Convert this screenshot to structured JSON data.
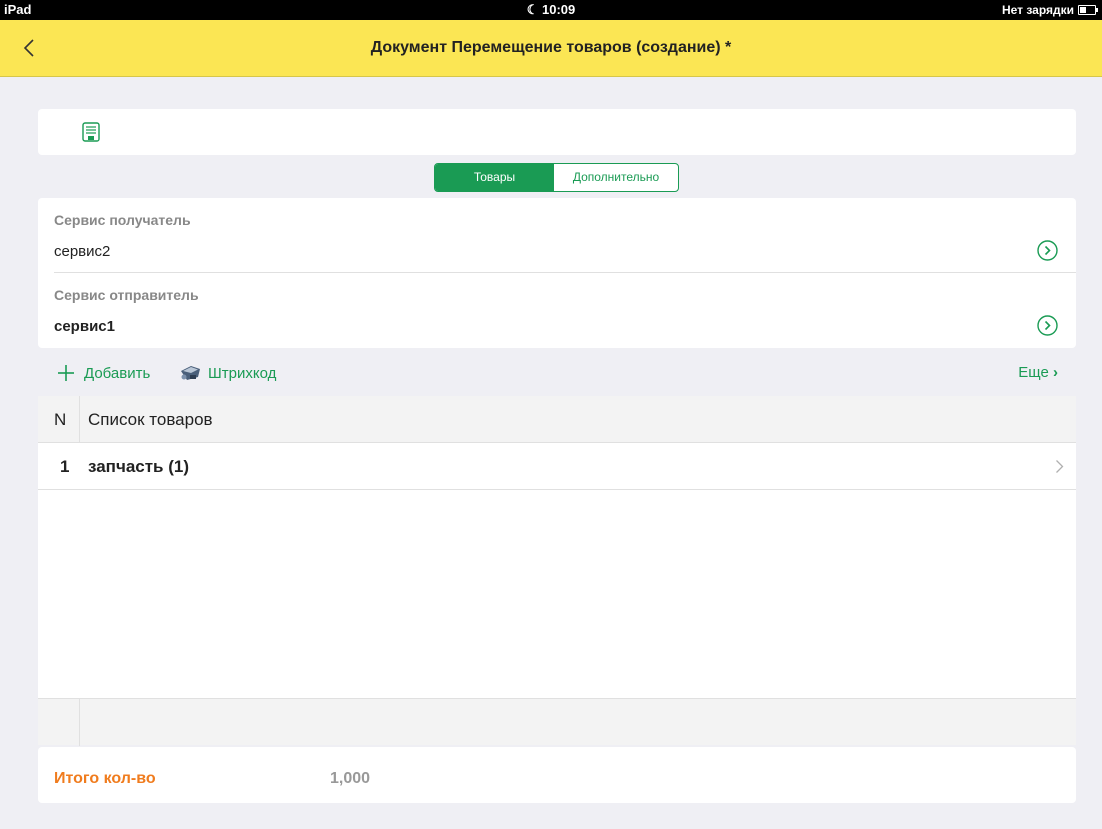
{
  "statusbar": {
    "carrier": "iPad",
    "time": "10:09",
    "battery_text": "Нет зарядки"
  },
  "navbar": {
    "title": "Документ Перемещение товаров (создание) *"
  },
  "tabs": [
    {
      "label": "Товары",
      "active": true
    },
    {
      "label": "Дополнительно",
      "active": false
    }
  ],
  "fields": {
    "recipient": {
      "label": "Сервис получатель",
      "value": "сервис2"
    },
    "sender": {
      "label": "Сервис отправитель",
      "value": "сервис1"
    }
  },
  "actions": {
    "add_label": "Добавить",
    "barcode_label": "Штрихкод",
    "more_label": "Еще"
  },
  "table": {
    "columns": [
      "N",
      "Список товаров"
    ],
    "rows": [
      {
        "n": "1",
        "name": "запчасть (1)"
      }
    ]
  },
  "total": {
    "label": "Итого кол-во",
    "value": "1,000"
  },
  "colors": {
    "accent": "#1a9b54",
    "navbar": "#fbe654",
    "total_label": "#f07c1e"
  },
  "icons": [
    "moon-icon",
    "battery-icon",
    "back-chevron-icon",
    "save-icon",
    "go-arrow-icon",
    "plus-icon",
    "barcode-scanner-icon",
    "chevron-right-icon"
  ]
}
